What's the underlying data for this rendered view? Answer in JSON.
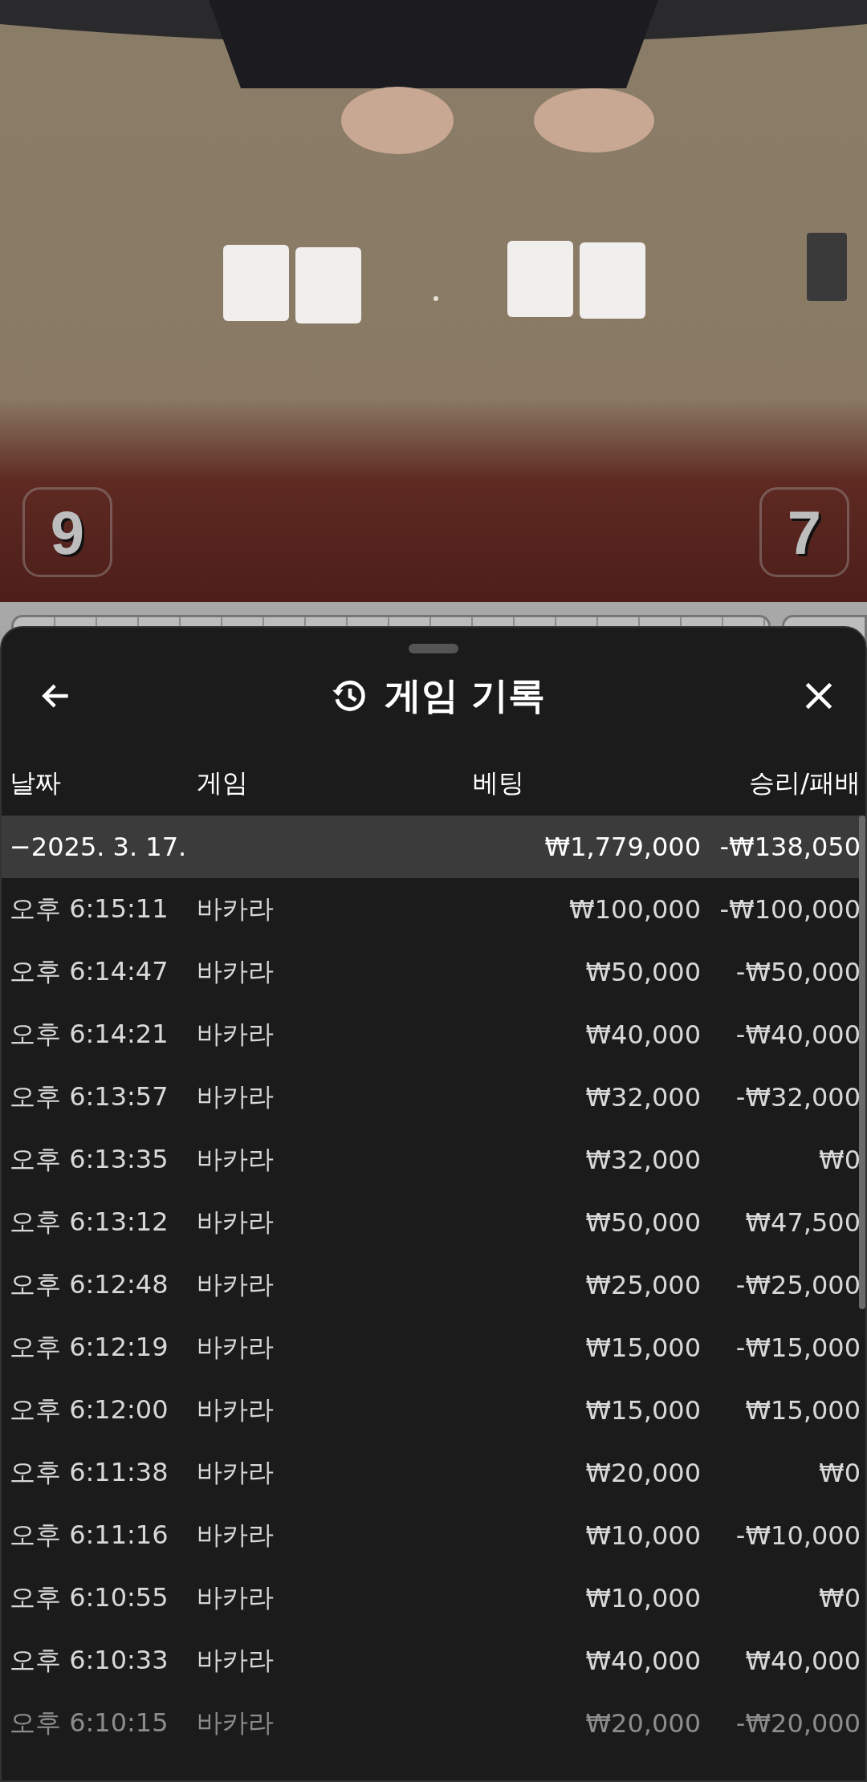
{
  "video": {
    "scores": [
      "9",
      "7"
    ]
  },
  "sheet": {
    "title": "게임 기록"
  },
  "table": {
    "columns": [
      "날짜",
      "게임",
      "베팅",
      "승리/패배"
    ],
    "group": {
      "date": "−2025. 3. 17.",
      "bet": "₩1,779,000",
      "result": "-₩138,050"
    },
    "rows": [
      {
        "time": "오후 6:15:11",
        "game": "바카라",
        "bet": "₩100,000",
        "result": "-₩100,000"
      },
      {
        "time": "오후 6:14:47",
        "game": "바카라",
        "bet": "₩50,000",
        "result": "-₩50,000"
      },
      {
        "time": "오후 6:14:21",
        "game": "바카라",
        "bet": "₩40,000",
        "result": "-₩40,000"
      },
      {
        "time": "오후 6:13:57",
        "game": "바카라",
        "bet": "₩32,000",
        "result": "-₩32,000"
      },
      {
        "time": "오후 6:13:35",
        "game": "바카라",
        "bet": "₩32,000",
        "result": "₩0"
      },
      {
        "time": "오후 6:13:12",
        "game": "바카라",
        "bet": "₩50,000",
        "result": "₩47,500"
      },
      {
        "time": "오후 6:12:48",
        "game": "바카라",
        "bet": "₩25,000",
        "result": "-₩25,000"
      },
      {
        "time": "오후 6:12:19",
        "game": "바카라",
        "bet": "₩15,000",
        "result": "-₩15,000"
      },
      {
        "time": "오후 6:12:00",
        "game": "바카라",
        "bet": "₩15,000",
        "result": "₩15,000"
      },
      {
        "time": "오후 6:11:38",
        "game": "바카라",
        "bet": "₩20,000",
        "result": "₩0"
      },
      {
        "time": "오후 6:11:16",
        "game": "바카라",
        "bet": "₩10,000",
        "result": "-₩10,000"
      },
      {
        "time": "오후 6:10:55",
        "game": "바카라",
        "bet": "₩10,000",
        "result": "₩0"
      },
      {
        "time": "오후 6:10:33",
        "game": "바카라",
        "bet": "₩40,000",
        "result": "₩40,000"
      },
      {
        "time": "오후 6:10:15",
        "game": "바카라",
        "bet": "₩20,000",
        "result": "-₩20,000"
      }
    ]
  }
}
